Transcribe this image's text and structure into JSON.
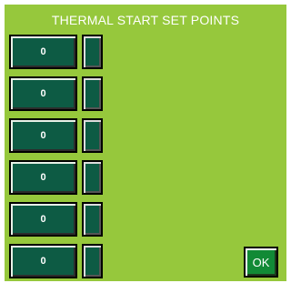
{
  "title": "THERMAL START SET POINTS",
  "setpoints": [
    {
      "value": "0"
    },
    {
      "value": "0"
    },
    {
      "value": "0"
    },
    {
      "value": "0"
    },
    {
      "value": "0"
    },
    {
      "value": "0"
    }
  ],
  "ok_label": "OK",
  "colors": {
    "panel_background": "#96c83c",
    "field_background": "#0d5b44",
    "ok_button_background": "#118a36",
    "text": "#ffffff"
  }
}
